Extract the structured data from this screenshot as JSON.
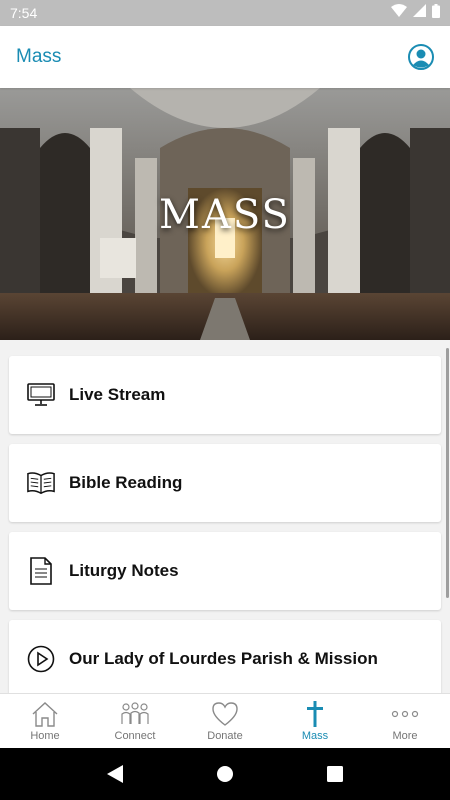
{
  "status_bar": {
    "time": "7:54",
    "icons": [
      "wifi-icon",
      "cell-signal-icon",
      "battery-icon"
    ]
  },
  "app_bar": {
    "title": "Mass",
    "profile_icon": "account-circle-icon"
  },
  "hero": {
    "title": "MASS"
  },
  "cards": [
    {
      "label": "Live Stream",
      "icon": "monitor-icon"
    },
    {
      "label": "Bible Reading",
      "icon": "open-book-icon"
    },
    {
      "label": "Liturgy Notes",
      "icon": "document-icon"
    },
    {
      "label": "Our Lady of Lourdes Parish & Mission",
      "icon": "play-circle-icon"
    }
  ],
  "bottom_nav": {
    "items": [
      {
        "label": "Home",
        "icon": "home-icon",
        "active": false
      },
      {
        "label": "Connect",
        "icon": "people-icon",
        "active": false
      },
      {
        "label": "Donate",
        "icon": "heart-icon",
        "active": false
      },
      {
        "label": "Mass",
        "icon": "cross-icon",
        "active": true
      },
      {
        "label": "More",
        "icon": "more-dots-icon",
        "active": false
      }
    ]
  },
  "colors": {
    "accent": "#1a8cb3",
    "status_bar": "#bdbdbd",
    "inactive": "#757575"
  }
}
